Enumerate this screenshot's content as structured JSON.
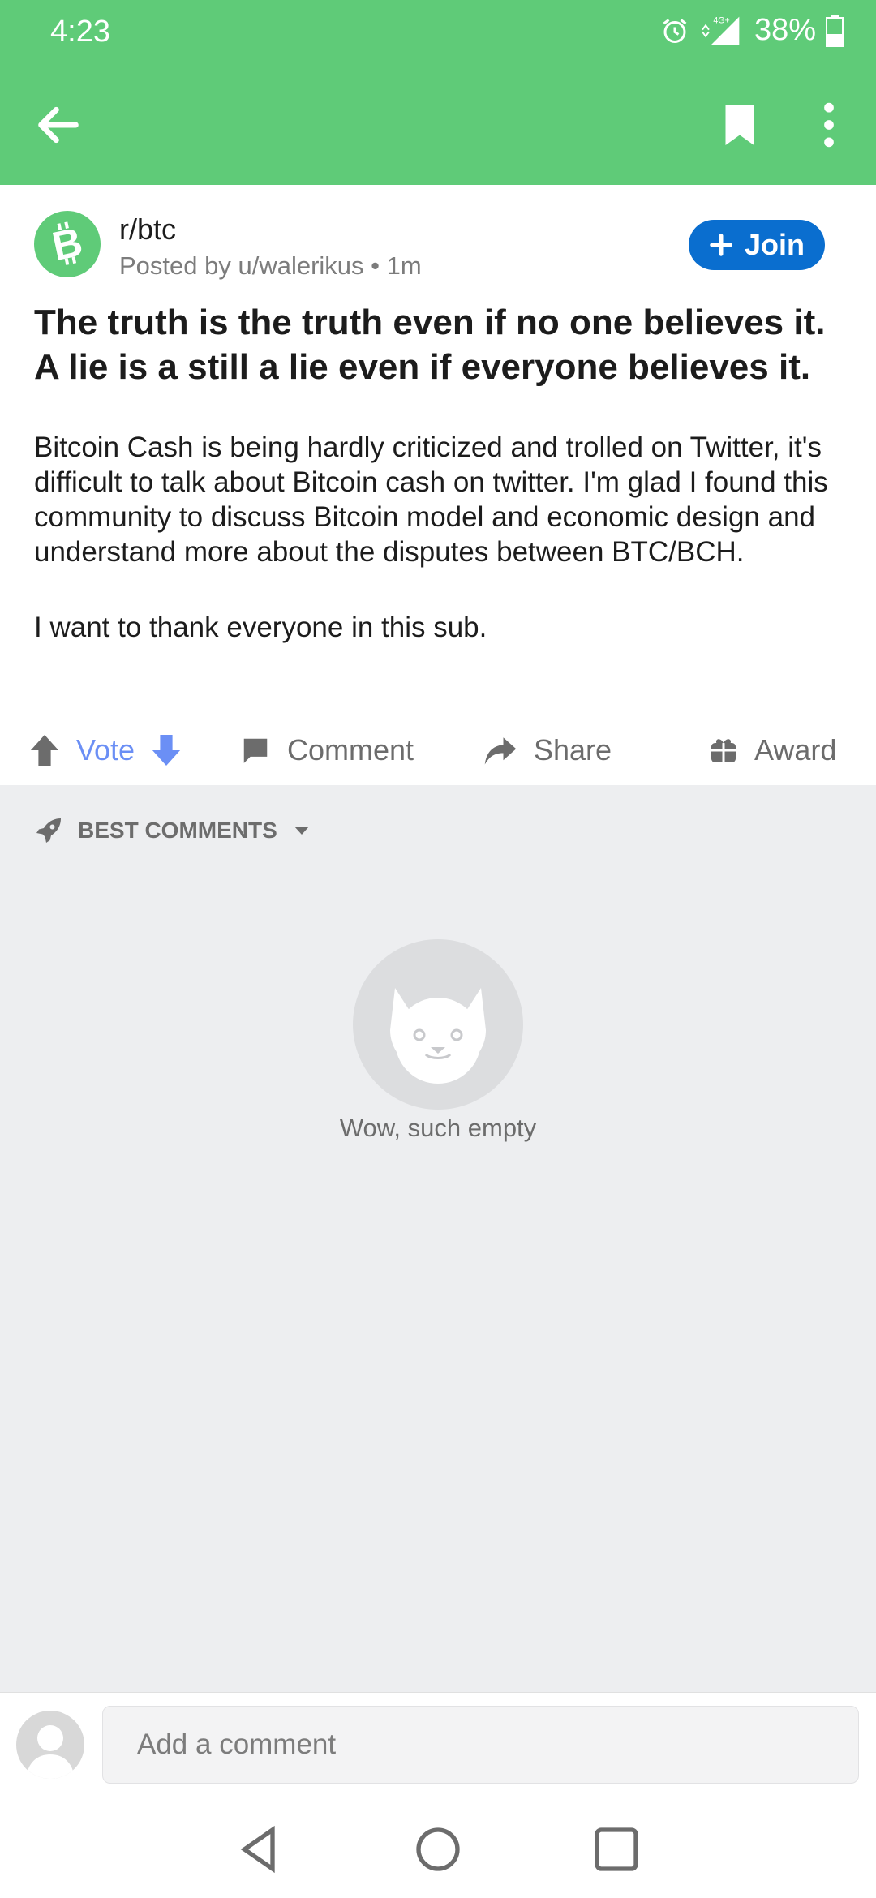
{
  "status_bar": {
    "time": "4:23",
    "network": "4G+",
    "battery": "38%"
  },
  "post": {
    "subreddit": "r/btc",
    "posted_by": "Posted by u/walerikus • 1m",
    "join_label": "Join",
    "title": "The truth is the truth even if no one believes it. A lie is a still a lie even if everyone believes it.",
    "body_p1": "Bitcoin Cash is being hardly criticized and trolled on Twitter, it's difficult to talk about Bitcoin cash on twitter. I'm glad I found this community to discuss Bitcoin model and economic design and understand more about the disputes between BTC/BCH.",
    "body_p2": "I want to thank everyone in this sub."
  },
  "actions": {
    "vote": "Vote",
    "comment": "Comment",
    "share": "Share",
    "award": "Award"
  },
  "comments": {
    "sort_label": "BEST COMMENTS",
    "empty_text": "Wow, such empty"
  },
  "comment_bar": {
    "placeholder": "Add a comment"
  },
  "colors": {
    "brand_green": "#5fcb78",
    "join_blue": "#0a6ecf",
    "vote_blue": "#6b8ff5"
  }
}
